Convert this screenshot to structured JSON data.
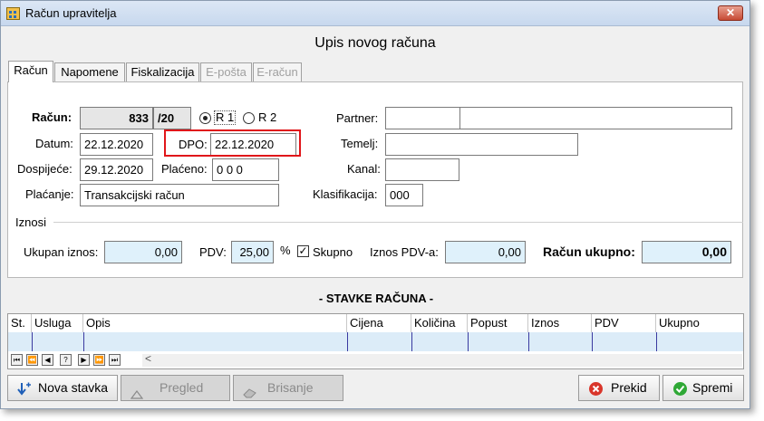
{
  "window": {
    "title": "Račun upravitelja",
    "close": "✕"
  },
  "heading": "Upis novog računa",
  "tabs": [
    "Račun",
    "Napomene",
    "Fiskalizacija",
    "E-pošta",
    "E-račun"
  ],
  "form": {
    "racun_label": "Račun:",
    "racun_number": "833",
    "racun_suffix": "/20",
    "r1_label": "R 1",
    "r2_label": "R 2",
    "datum_label": "Datum:",
    "datum_value": "22.12.2020",
    "dpo_label": "DPO:",
    "dpo_value": "22.12.2020",
    "dospijece_label": "Dospijeće:",
    "dospijece_value": "29.12.2020",
    "placeno_label": "Plaćeno:",
    "placeno_value": "0 0  0",
    "placanje_label": "Plaćanje:",
    "placanje_value": "Transakcijski račun",
    "partner_label": "Partner:",
    "temelj_label": "Temelj:",
    "kanal_label": "Kanal:",
    "klasifikacija_label": "Klasifikacija:",
    "klasifikacija_value": "000"
  },
  "iznosi": {
    "group_label": "Iznosi",
    "ukupan_label": "Ukupan iznos:",
    "ukupan_value": "0,00",
    "pdv_label": "PDV:",
    "pdv_value": "25,00",
    "pdv_unit": "%",
    "skupno_label": "Skupno",
    "iznos_pdv_label": "Iznos PDV-a:",
    "iznos_pdv_value": "0,00",
    "racun_ukupno_label": "Račun ukupno:",
    "racun_ukupno_value": "0,00"
  },
  "stavke": {
    "title": "- STAVKE RAČUNA -",
    "columns": [
      "St.",
      "Usluga",
      "Opis",
      "Cijena",
      "Količina",
      "Popust",
      "Iznos",
      "PDV",
      "Ukupno"
    ],
    "nav": [
      "⏮",
      "⏪",
      "◀",
      "?",
      "▶",
      "⏩",
      "⏭",
      "<"
    ]
  },
  "buttons": {
    "nova_stavka": "Nova stavka",
    "pregled": "Pregled",
    "brisanje": "Brisanje",
    "prekid": "Prekid",
    "spremi": "Spremi"
  }
}
